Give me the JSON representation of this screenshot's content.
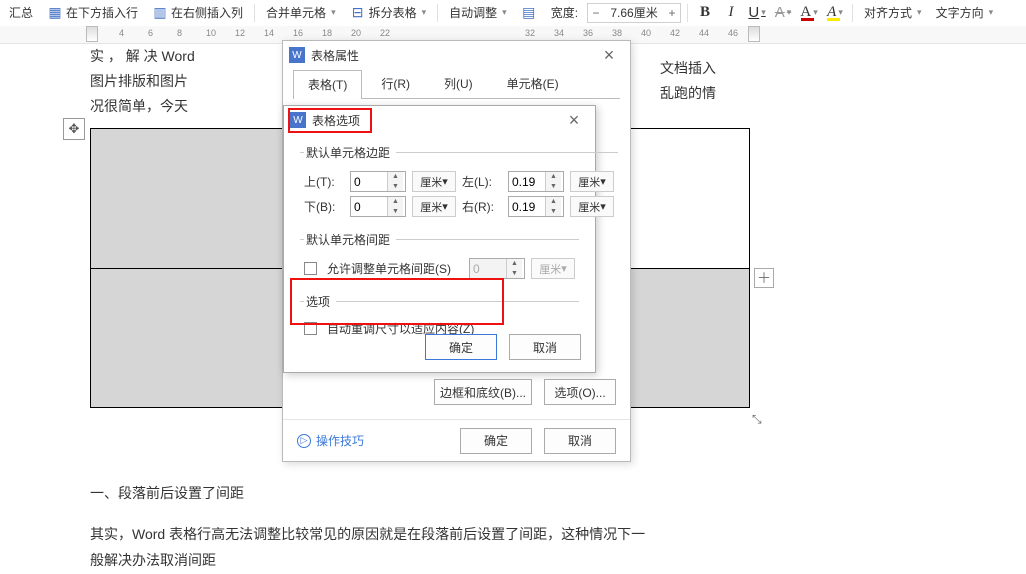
{
  "toolbar": {
    "summarize": "汇总",
    "insert_row_below": "在下方插入行",
    "insert_col_right": "在右侧插入列",
    "merge_cells": "合并单元格",
    "split_table": "拆分表格",
    "autofit": "自动调整",
    "width_label": "宽度:",
    "width_value": "7.66厘米",
    "bold": "B",
    "italic": "I",
    "underline": "U",
    "strike": "A",
    "font_color_letter": "A",
    "highlight_letter": "A",
    "align": "对齐方式",
    "text_direction": "文字方向"
  },
  "ruler": {
    "ticks": [
      4,
      6,
      8,
      10,
      12,
      14,
      16,
      18,
      20,
      22,
      32,
      34,
      36,
      38,
      40,
      42,
      44,
      46
    ]
  },
  "doc_text": {
    "l1": "实 ， 解 决  Word",
    "l2": "图片排版和图片",
    "l3": "况很简单，今天",
    "r1": "文档插入",
    "r2": "乱跑的情",
    "heading": "一、段落前后设置了间距",
    "para": "其实，Word 表格行高无法调整比较常见的原因就是在段落前后设置了间距，这种情况下一",
    "para2": "般解决办法取消间距"
  },
  "outer_dialog": {
    "title": "表格属性",
    "tabs": {
      "table": "表格(T)",
      "row": "行(R)",
      "column": "列(U)",
      "cell": "单元格(E)"
    },
    "btn_border": "边框和底纹(B)...",
    "btn_options": "选项(O)...",
    "ok": "确定",
    "cancel": "取消",
    "tips": "操作技巧"
  },
  "inner_dialog": {
    "title": "表格选项",
    "group_margin": "默认单元格边距",
    "top": "上(T):",
    "top_v": "0",
    "bottom": "下(B):",
    "bottom_v": "0",
    "left": "左(L):",
    "left_v": "0.19",
    "right": "右(R):",
    "right_v": "0.19",
    "unit": "厘米",
    "group_spacing": "默认单元格间距",
    "allow_spacing": "允许调整单元格间距(S)",
    "spacing_v": "0",
    "group_opts": "选项",
    "auto_resize": "自动重调尺寸以适应内容(Z)",
    "ok": "确定",
    "cancel": "取消"
  },
  "icons": {
    "move": "✥",
    "plus": "＋",
    "resize": "⤡",
    "play": "▷"
  }
}
